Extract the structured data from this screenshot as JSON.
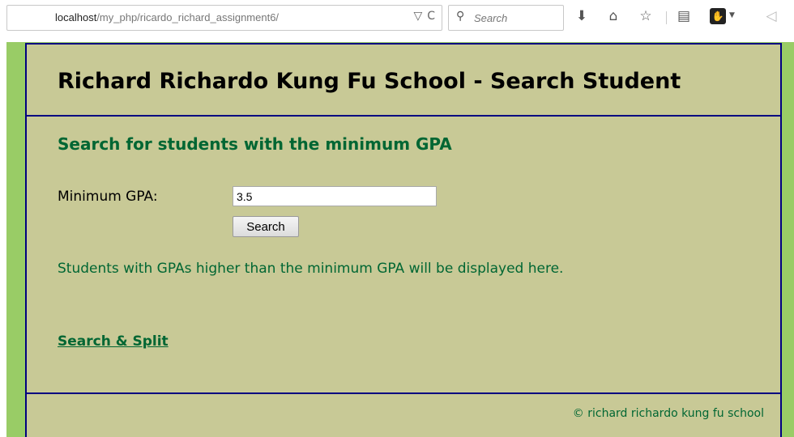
{
  "browser": {
    "url_host": "localhost",
    "url_path": "/my_php/ricardo_richard_assignment6/",
    "search_placeholder": "Search",
    "icons": [
      "dropdown-icon",
      "reload-icon",
      "search-icon",
      "download-icon",
      "home-icon",
      "bookmark-star-icon",
      "reading-list-icon",
      "extension-icon",
      "share-icon"
    ]
  },
  "header": {
    "title": "Richard Richardo Kung Fu School - Search Student"
  },
  "main": {
    "heading": "Search for students with the minimum GPA",
    "gpa_label": "Minimum GPA:",
    "gpa_value": "3.5",
    "search_button": "Search",
    "result_text": "Students with GPAs higher than the minimum GPA will be displayed here.",
    "nav_link": "Search & Split"
  },
  "footer": {
    "copyright": "© richard richardo kung fu school"
  },
  "colors": {
    "page_green": "#99cc66",
    "panel": "#c8c996",
    "border": "#000080",
    "text_green": "#006633"
  }
}
